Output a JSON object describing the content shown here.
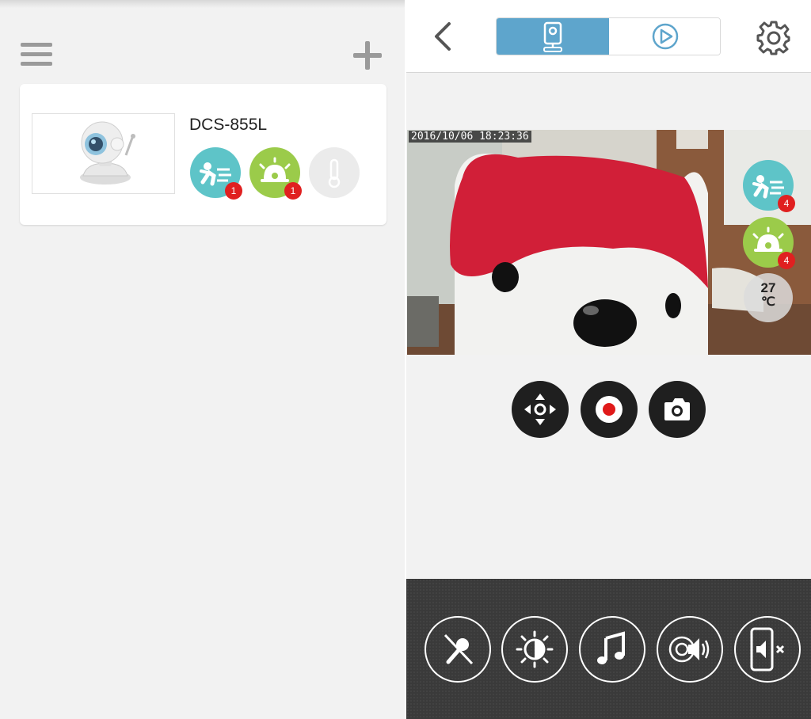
{
  "left_panel": {
    "menu_icon": "hamburger-menu-icon",
    "add_icon": "plus-icon",
    "device": {
      "name": "DCS-855L",
      "motion_badge": "1",
      "sound_badge": "1",
      "icons": [
        "motion-detect-icon",
        "sound-detect-icon",
        "thermometer-icon"
      ]
    }
  },
  "right_panel": {
    "header": {
      "back_icon": "chevron-left-icon",
      "tabs": [
        "camera-live-icon",
        "playback-icon"
      ],
      "settings_icon": "gear-icon"
    },
    "video": {
      "timestamp": "2016/10/06 18:23:36",
      "motion_badge": "4",
      "sound_badge": "4",
      "temperature": "27",
      "temperature_unit": "℃"
    },
    "controls": [
      "pan-tilt-icon",
      "record-icon",
      "snapshot-camera-icon"
    ],
    "bottom_bar": [
      "microphone-muted-icon",
      "brightness-icon",
      "music-note-icon",
      "speaker-broadcast-icon",
      "phone-mute-icon"
    ]
  },
  "colors": {
    "accent_blue": "#5ea5cc",
    "motion_teal": "#5ec4c8",
    "sound_green": "#9bcb4a",
    "badge_red": "#e02020",
    "control_dark": "#1f1f1f",
    "bottom_bar": "#3a3a3a"
  }
}
